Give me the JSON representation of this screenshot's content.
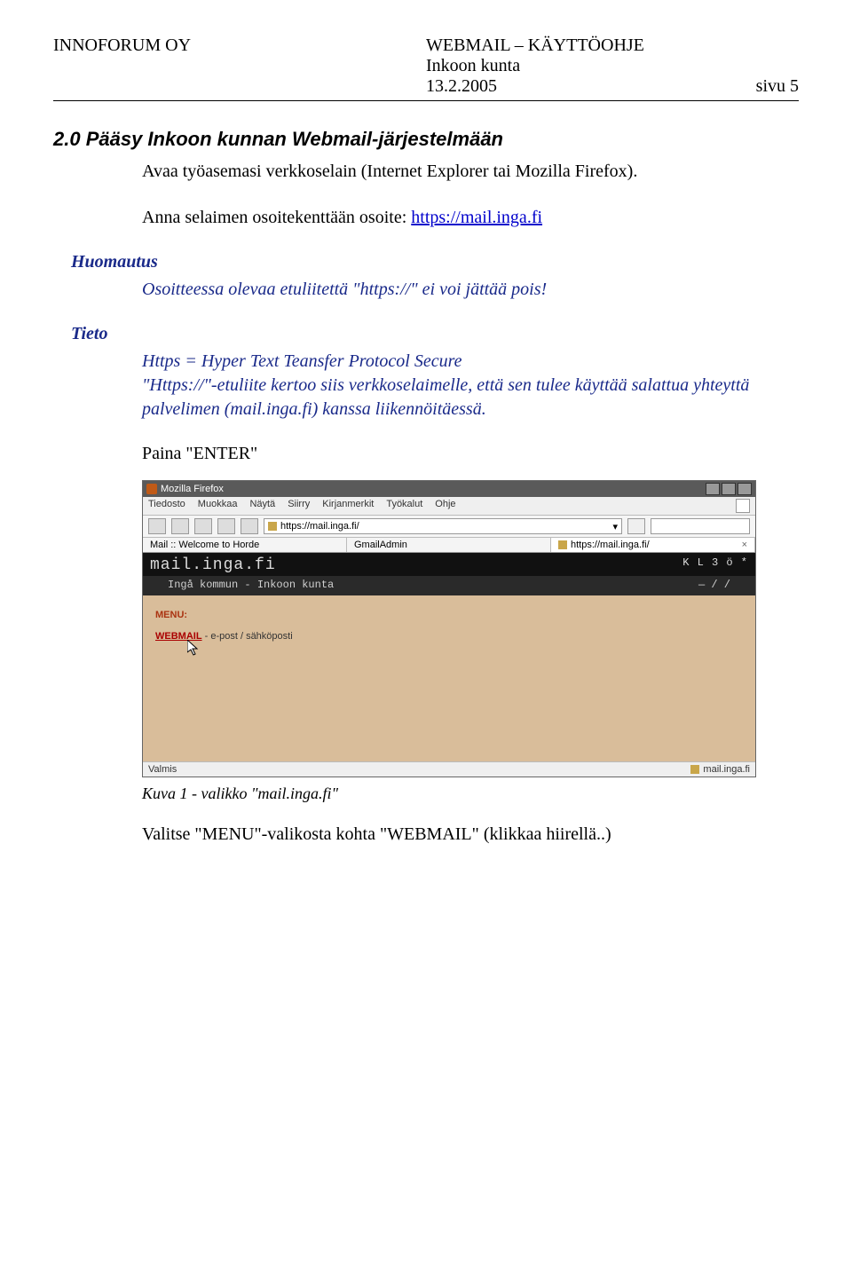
{
  "header": {
    "company": "INNOFORUM OY",
    "title": "WEBMAIL – KÄYTTÖOHJE",
    "subtitle": "Inkoon kunta",
    "date": "13.2.2005",
    "page": "sivu 5"
  },
  "section": {
    "heading": "2.0 Pääsy Inkoon kunnan Webmail-järjestelmään",
    "p1": "Avaa työasemasi verkkoselain (Internet Explorer tai Mozilla Firefox).",
    "p2a": "Anna selaimen osoitekenttään osoite: ",
    "p2link": "https://mail.inga.fi"
  },
  "huomautus": {
    "title": "Huomautus",
    "text": "Osoitteessa olevaa etuliitettä \"https://\" ei voi jättää pois!"
  },
  "tieto": {
    "title": "Tieto",
    "line1": "Https = Hyper Text Teansfer Protocol Secure",
    "line2": "\"Https://\"-etuliite kertoo siis verkkoselaimelle, että sen tulee käyttää salattua yhteyttä palvelimen (mail.inga.fi) kanssa liikennöitäessä."
  },
  "press_enter": "Paina \"ENTER\"",
  "screenshot": {
    "window_title": "Mozilla Firefox",
    "menus": [
      "Tiedosto",
      "Muokkaa",
      "Näytä",
      "Siirry",
      "Kirjanmerkit",
      "Työkalut",
      "Ohje"
    ],
    "url": "https://mail.inga.fi/",
    "tabs": [
      {
        "label": "Mail :: Welcome to Horde"
      },
      {
        "label": "GmailAdmin"
      },
      {
        "label": "https://mail.inga.fi/"
      }
    ],
    "banner_domain": "mail.inga.fi",
    "banner_sub": "Ingå kommun - Inkoon kunta",
    "menu_label": "MENU:",
    "webmail_link": "WEBMAIL",
    "webmail_desc": " - e-post / sähköposti",
    "status_left": "Valmis",
    "status_right": "mail.inga.fi"
  },
  "figure_caption": "Kuva 1 - valikko \"mail.inga.fi\"",
  "final": "Valitse \"MENU\"-valikosta kohta \"WEBMAIL\" (klikkaa hiirellä..)"
}
